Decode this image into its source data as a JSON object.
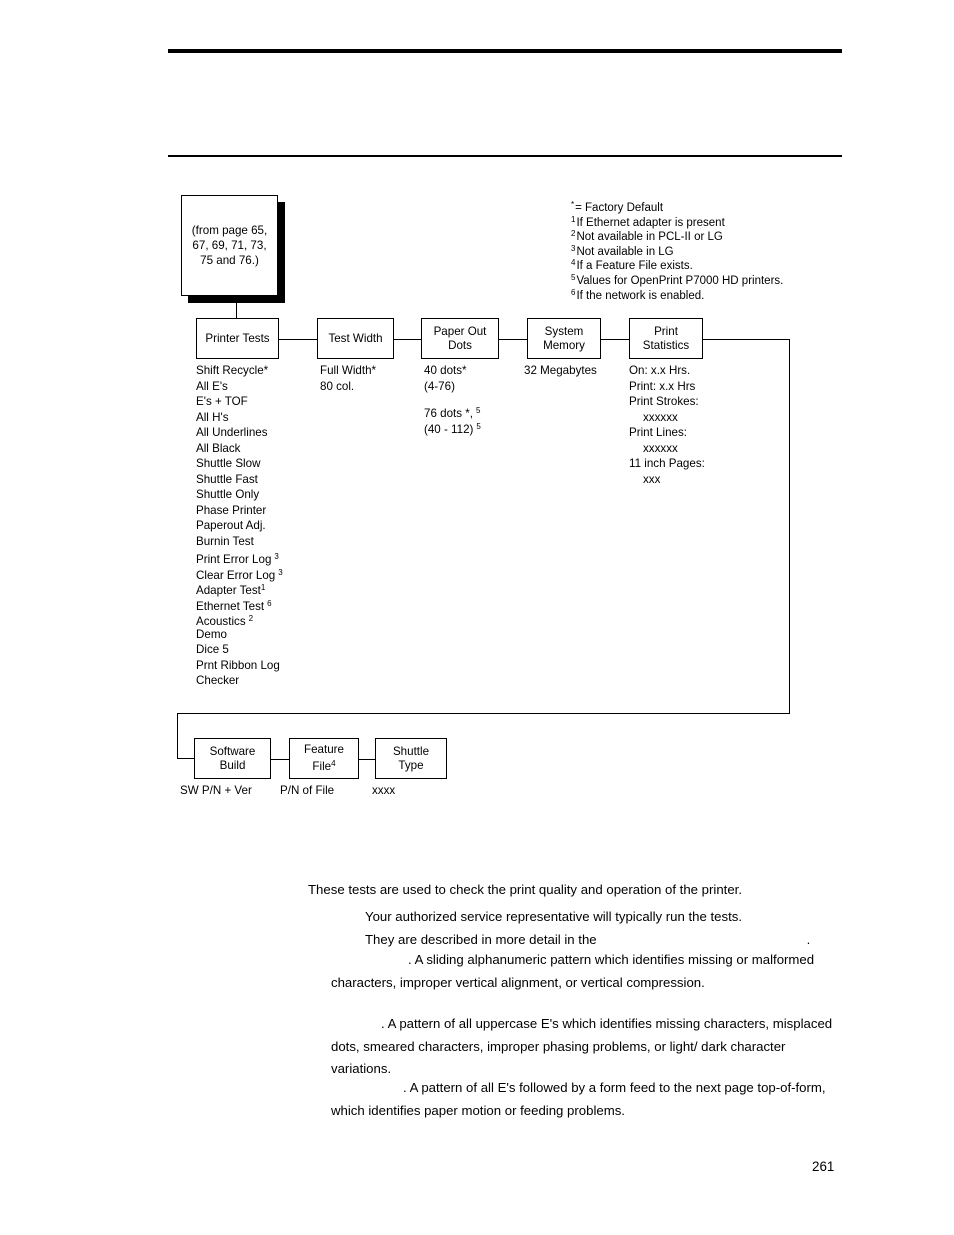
{
  "page": {
    "number": "261"
  },
  "legend": {
    "items": [
      {
        "marker": "*",
        "text": "= Factory Default"
      },
      {
        "marker": "1",
        "text": "If Ethernet adapter is present"
      },
      {
        "marker": "2",
        "text": "Not available in PCL-II or LG"
      },
      {
        "marker": "3",
        "text": "Not available in LG"
      },
      {
        "marker": "4",
        "text": "If a Feature File exists."
      },
      {
        "marker": "5",
        "text": "Values for OpenPrint P7000 HD printers."
      },
      {
        "marker": "6",
        "text": "If the network is enabled."
      }
    ]
  },
  "source_box": {
    "line1": "(from page 65,",
    "line2": "67, 69, 71, 73,",
    "line3": "75 and 76.)"
  },
  "flow": {
    "row1": [
      {
        "title_line1": "Printer Tests",
        "title_line2": "",
        "items": [
          "Shift Recycle*",
          "All E's",
          "E's + TOF",
          "All H's",
          "All Underlines",
          "All Black",
          "Shuttle Slow",
          "Shuttle Fast",
          "Shuttle Only",
          "Phase Printer",
          "Paperout Adj.",
          "Burnin Test",
          "Print Error Log",
          "Clear Error Log",
          "Adapter Test",
          "Ethernet Test",
          "Acoustics",
          "Demo",
          "Dice 5",
          "Prnt Ribbon Log",
          "Checker"
        ]
      },
      {
        "title_line1": "Test Width",
        "title_line2": "",
        "items": [
          "Full Width*",
          "80 col."
        ]
      },
      {
        "title_line1": "Paper Out",
        "title_line2": "Dots",
        "items": [
          "40 dots*",
          "(4-76)",
          "76 dots *,",
          "(40 - 112)"
        ]
      },
      {
        "title_line1": "System",
        "title_line2": "Memory",
        "items": [
          "32 Megabytes"
        ]
      },
      {
        "title_line1": "Print",
        "title_line2": "Statistics",
        "items": [
          "On: x.x Hrs.",
          "Print: x.x Hrs",
          "Print Strokes:",
          "xxxxxx",
          "Print Lines:",
          "xxxxxx",
          "11 inch Pages:",
          "xxx"
        ]
      }
    ],
    "row2": [
      {
        "title_line1": "Software",
        "title_line2": "Build",
        "value": "SW P/N + Ver"
      },
      {
        "title_line1": "Feature",
        "title_line2": "File",
        "title_sup": "4",
        "value": "P/N of File"
      },
      {
        "title_line1": "Shuttle",
        "title_line2": "Type",
        "value": "xxxx"
      }
    ]
  },
  "body": {
    "p1": "These tests are used to check the print quality and operation of the printer.",
    "p2_line1": "Your authorized service representative will typically run the tests.",
    "p2_line2_pre": "They are described in more detail in the",
    "p2_line2_post": ".",
    "p3": ". A sliding alphanumeric pattern which identifies missing or malformed characters, improper vertical alignment, or vertical compression.",
    "p4": ". A pattern of all uppercase E's which identifies missing characters, misplaced dots, smeared characters, improper phasing problems, or light/ dark character variations.",
    "p5": ". A pattern of all E's followed by a form feed to the next page top-of-form, which identifies paper motion or feeding problems."
  }
}
